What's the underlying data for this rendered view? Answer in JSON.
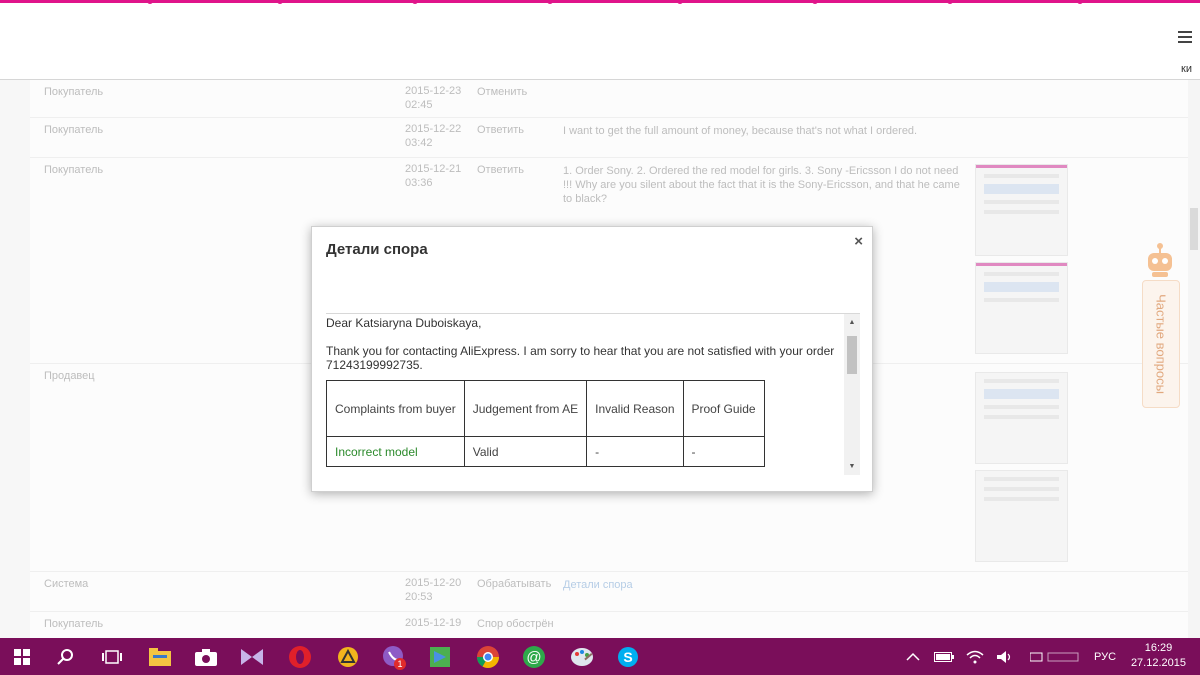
{
  "browser": {
    "menu_fragment": "ки"
  },
  "rows": [
    {
      "who": "Покупатель",
      "date": "2015-12-23",
      "time": "02:45",
      "action": "Отменить",
      "message": ""
    },
    {
      "who": "Покупатель",
      "date": "2015-12-22",
      "time": "03:42",
      "action": "Ответить",
      "message": "I want to get the full amount of money, because that's not what I ordered."
    },
    {
      "who": "Покупатель",
      "date": "2015-12-21",
      "time": "03:36",
      "action": "Ответить",
      "message": "1. Order Sony. 2. Ordered the red model for girls. 3. Sony -Ericsson I do not need !!! Why are you silent about the fact that it is the Sony-Ericsson, and that he came to black?"
    },
    {
      "who": "Продавец",
      "date": "",
      "time": "",
      "action": "",
      "message": ""
    },
    {
      "who": "Система",
      "date": "2015-12-20",
      "time": "20:53",
      "action": "Обрабатывать",
      "link": "Детали спора"
    },
    {
      "who": "Покупатель",
      "date": "2015-12-19",
      "time": "",
      "action": "Спор обострён",
      "message": ""
    }
  ],
  "faq": {
    "label": "Частые вопросы"
  },
  "modal": {
    "title": "Детали спора",
    "close": "×",
    "greeting": "Dear Katsiaryna Duboiskaya,",
    "paragraph": "Thank you for contacting AliExpress. I am sorry to hear that you are not satisfied with your order 71243199992735.",
    "table": {
      "headers": [
        "Complaints from buyer",
        "Judgement from AE",
        "Invalid Reason",
        "Proof Guide"
      ],
      "row": [
        "Incorrect model",
        "Valid",
        "-",
        "-"
      ]
    }
  },
  "taskbar": {
    "viber_badge": "1",
    "language": "РУС",
    "time": "16:29",
    "date": "27.12.2015"
  }
}
